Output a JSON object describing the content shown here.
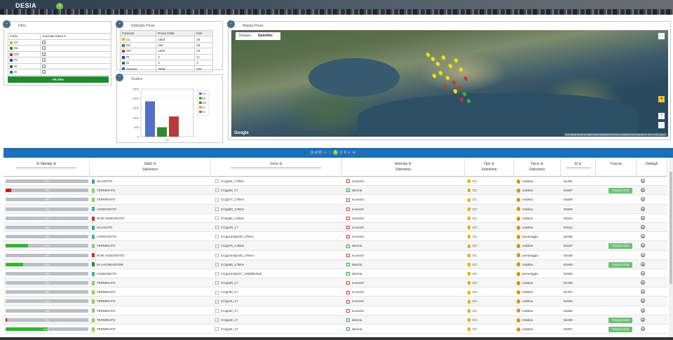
{
  "app": {
    "brand": "DESIA"
  },
  "filtro": {
    "title": "Filtro",
    "col_turno": "Turno",
    "col_select": "Giornata Intera",
    "rows": [
      {
        "label": "CC",
        "color": "#e8b000"
      },
      {
        "label": "ML",
        "color": "#2e8b2e"
      },
      {
        "label": "OR",
        "color": "#c0392b"
      },
      {
        "label": "PL",
        "color": "#1f3fbf"
      },
      {
        "label": "SI",
        "color": "#5a5a5a"
      },
      {
        "label": "Si",
        "color": "#1f6fb8"
      }
    ],
    "button": "FILTRA"
  },
  "dettaglio": {
    "title": "Dettaglio Prese",
    "headers": [
      "Frazione",
      "Prese Fatte",
      "Gds"
    ],
    "rows": [
      {
        "label": "CC",
        "fatte": "1853",
        "gds": "29",
        "color": "#e8b000"
      },
      {
        "label": "ML",
        "fatte": "492",
        "gds": "18",
        "color": "#2e8b2e"
      },
      {
        "label": "OR",
        "fatte": "1063",
        "gds": "40",
        "color": "#c0392b"
      },
      {
        "label": "PL",
        "fatte": "0",
        "gds": "11",
        "color": "#1f3fbf"
      },
      {
        "label": "SI",
        "fatte": "0",
        "gds": "3",
        "color": "#5a5a5a"
      },
      {
        "label": "Somma",
        "fatte": "3408",
        "gds": "101",
        "color": "#1f6fb8"
      }
    ]
  },
  "grafico": {
    "title": "Grafico"
  },
  "chart_data": {
    "type": "bar",
    "categories": [
      "CC"
    ],
    "series": [
      {
        "name": "CC",
        "values": [
          1853
        ],
        "color": "#5470c6"
      },
      {
        "name": "ML",
        "values": [
          492
        ],
        "color": "#2e8b2e"
      },
      {
        "name": "OR",
        "values": [
          1063
        ],
        "color": "#b73a3a"
      },
      {
        "name": "PL",
        "values": [
          0
        ],
        "color": "#e8a000"
      },
      {
        "name": "SI",
        "values": [
          0
        ],
        "color": "#9b59b6"
      }
    ],
    "ylim": [
      0,
      2500
    ],
    "yticks": [
      "2500",
      "2000",
      "1500",
      "1000",
      "500",
      "0"
    ],
    "xlabel": "CC"
  },
  "mappa": {
    "title": "Mappa Prese",
    "btn_map": "Mappa",
    "btn_sat": "Satellite",
    "logo": "Google",
    "copyright": "Dati mappa ©2019 Immagini ©2019 TerraMetrics  Termini e condizioni d'uso  Segnala un errore nella mappa"
  },
  "pager": {
    "info": "(1 of 3)",
    "first": "|<",
    "prev": "<",
    "pages": [
      "1",
      "2",
      "3"
    ],
    "next": ">",
    "last": ">|"
  },
  "columns": [
    {
      "label": "% Stimata",
      "sel": ""
    },
    {
      "label": "Stato",
      "sel": "Seleziona"
    },
    {
      "label": "Zona",
      "sel": ""
    },
    {
      "label": "Azienda",
      "sel": "Seleziona"
    },
    {
      "label": "Tipo",
      "sel": "Seleziona"
    },
    {
      "label": "Turno",
      "sel": "Seleziona"
    },
    {
      "label": "Id",
      "sel": ""
    },
    {
      "label": "Traccia",
      "sel": ""
    },
    {
      "label": "Dettagli",
      "sel": ""
    }
  ],
  "rows": [
    {
      "pct": "0%",
      "fill": 0,
      "fc": "#c00",
      "stato": "SCADUTO",
      "sc": "#3a9",
      "zona": "CCpp81_17Mov",
      "azienda": "econord",
      "ac": "#c44",
      "tipo": "CC",
      "turno": "mattina",
      "id": "61481",
      "traccia": ""
    },
    {
      "pct": "7%",
      "fill": 0.07,
      "fc": "#d11",
      "stato": "TERMINATO",
      "sc": "#8fd14f",
      "zona": "CCpp64_17",
      "azienda": "devizia",
      "ac": "#3a3",
      "tipo": "CC",
      "turno": "mattina",
      "id": "61507",
      "traccia": "Traccia Gds"
    },
    {
      "pct": "0%",
      "fill": 0,
      "fc": "#c00",
      "stato": "TERMINATO",
      "sc": "#8fd14f",
      "zona": "CCpp77_17Mov",
      "azienda": "econord",
      "ac": "#c44",
      "tipo": "CC",
      "turno": "mattina",
      "id": "61508",
      "traccia": ""
    },
    {
      "pct": "0%",
      "fill": 0,
      "fc": "#c00",
      "stato": "ASSEGNATO",
      "sc": "#3cb3a0",
      "zona": "CCpp83_17Mov",
      "azienda": "econord",
      "ac": "#c44",
      "tipo": "CC",
      "turno": "mattina",
      "id": "61509",
      "traccia": ""
    },
    {
      "pct": "0%",
      "fill": 0,
      "fc": "#c00",
      "stato": "NON ASSEGNATO",
      "sc": "#d12b2b",
      "zona": "CCpp82_17Mov",
      "azienda": "econord",
      "ac": "#c44",
      "tipo": "CC",
      "turno": "mattina",
      "id": "61510",
      "traccia": ""
    },
    {
      "pct": "0%",
      "fill": 0,
      "fc": "#c00",
      "stato": "SCADUTO",
      "sc": "#3a9",
      "zona": "CCpp49_17",
      "azienda": "econord",
      "ac": "#c44",
      "tipo": "CC",
      "turno": "mattina",
      "id": "61511",
      "traccia": ""
    },
    {
      "pct": "0%",
      "fill": 0,
      "fc": "#c00",
      "stato": "ASSEGNATO",
      "sc": "#3cb3a0",
      "zona": "CCppUnSpc05_17Mov",
      "azienda": "econord",
      "ac": "#c44",
      "tipo": "CC",
      "turno": "pomeriggio",
      "id": "61536",
      "traccia": ""
    },
    {
      "pct": "27%",
      "fill": 0.27,
      "fc": "#2db82d",
      "stato": "TERMINATO",
      "sc": "#8fd14f",
      "zona": "CCpp79_17Mov",
      "azienda": "devizia",
      "ac": "#3a3",
      "tipo": "CC",
      "turno": "mattina",
      "id": "61537",
      "traccia": "Traccia Gds"
    },
    {
      "pct": "0%",
      "fill": 0,
      "fc": "#c00",
      "stato": "NON ASSEGNATO",
      "sc": "#d12b2b",
      "zona": "CCppUnSpc05_17Mov",
      "azienda": "econord",
      "ac": "#c44",
      "tipo": "CC",
      "turno": "pomeriggio",
      "id": "61538",
      "traccia": ""
    },
    {
      "pct": "21%",
      "fill": 0.21,
      "fc": "#2db82d",
      "stato": "IN LAVORAZIONE",
      "sc": "#2a8a2a",
      "zona": "CCpp80_17Mov",
      "azienda": "devizia",
      "ac": "#3a3",
      "tipo": "CC",
      "turno": "mattina",
      "id": "61559",
      "traccia": "Traccia Gds"
    },
    {
      "pct": "0%",
      "fill": 0,
      "fc": "#c00",
      "stato": "ASSEGNATO",
      "sc": "#3cb3a0",
      "zona": "CCppUnSpc07_UNDBluNott",
      "azienda": "devizia",
      "ac": "#3a3",
      "tipo": "CC",
      "turno": "pomeriggio",
      "id": "61560",
      "traccia": ""
    },
    {
      "pct": "0%",
      "fill": 0,
      "fc": "#c00",
      "stato": "TERMINATO",
      "sc": "#8fd14f",
      "zona": "CCpp38_17",
      "azienda": "econord",
      "ac": "#c44",
      "tipo": "CC",
      "turno": "mattina",
      "id": "61756",
      "traccia": ""
    },
    {
      "pct": "0%",
      "fill": 0,
      "fc": "#c00",
      "stato": "TERMINATO",
      "sc": "#8fd14f",
      "zona": "CCpp48_17",
      "azienda": "econord",
      "ac": "#c44",
      "tipo": "CC",
      "turno": "mattina",
      "id": "61757",
      "traccia": ""
    },
    {
      "pct": "0%",
      "fill": 0,
      "fc": "#c00",
      "stato": "TERMINATO",
      "sc": "#8fd14f",
      "zona": "CCpp41_17",
      "azienda": "econord",
      "ac": "#c44",
      "tipo": "CC",
      "turno": "mattina",
      "id": "61804",
      "traccia": ""
    },
    {
      "pct": "0%",
      "fill": 0,
      "fc": "#c00",
      "stato": "TERMINATO",
      "sc": "#8fd14f",
      "zona": "CCpp30_17",
      "azienda": "econord",
      "ac": "#c44",
      "tipo": "CC",
      "turno": "mattina",
      "id": "61805",
      "traccia": ""
    },
    {
      "pct": "2%",
      "fill": 0.02,
      "fc": "#d11",
      "stato": "TERMINATO",
      "sc": "#8fd14f",
      "zona": "CCpp42_17",
      "azienda": "devizia",
      "ac": "#3a3",
      "tipo": "CC",
      "turno": "mattina",
      "id": "61806",
      "traccia": "Traccia Gds"
    },
    {
      "pct": "51%",
      "fill": 0.51,
      "fc": "#2db82d",
      "stato": "TERMINATO",
      "sc": "#8fd14f",
      "zona": "CCpp31_17",
      "azienda": "devizia",
      "ac": "#3a3",
      "tipo": "CC",
      "turno": "mattina",
      "id": "61807",
      "traccia": "Traccia Gds"
    }
  ]
}
